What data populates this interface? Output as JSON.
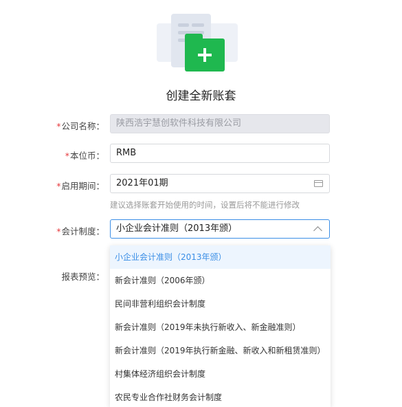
{
  "title": "创建全新账套",
  "form": {
    "company": {
      "required": "*",
      "label": "公司名称：",
      "value": "陕西浩宇慧创软件科技有限公司"
    },
    "currency": {
      "required": "*",
      "label": "本位币：",
      "value": "RMB"
    },
    "start_period": {
      "required": "*",
      "label": "启用期间：",
      "value": "2021年01期",
      "hint": "建议选择账套开始使用的时间，设置后将不能进行修改",
      "icon": "calendar-icon"
    },
    "accounting_system": {
      "required": "*",
      "label": "会计制度：",
      "value": "小企业会计准则（2013年颁）",
      "icon": "chevron-up-icon"
    },
    "report_preview": {
      "label": "报表预览："
    }
  },
  "dropdown": {
    "options": [
      "小企业会计准则（2013年颁）",
      "新会计准则（2006年颁）",
      "民间非营利组织会计制度",
      "新会计准则（2019年未执行新收入、新金融准则）",
      "新会计准则（2019年执行新金融、新收入和新租赁准则）",
      "村集体经济组织会计制度",
      "农民专业合作社财务会计制度"
    ],
    "selected_index": 0
  },
  "colors": {
    "accent": "#3a8ee6",
    "brand_green": "#1fb84f",
    "required": "#e6393d"
  }
}
